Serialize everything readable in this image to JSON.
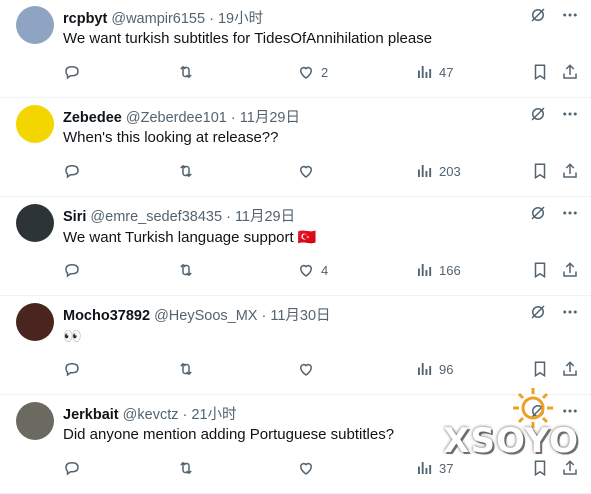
{
  "tweets": [
    {
      "name": "rcpbyt",
      "handle": "@wampir6155",
      "dot": "·",
      "time": "19小时",
      "text": "We want turkish subtitles for TidesOfAnnihilation please",
      "likes": "2",
      "views": "47",
      "avatar": "#8fa3c2"
    },
    {
      "name": "Zebedee",
      "handle": "@Zeberdee101",
      "dot": "·",
      "time": "11月29日",
      "text": "When's this looking at release??",
      "likes": "",
      "views": "203",
      "avatar": "#f3d500"
    },
    {
      "name": "Siri",
      "handle": "@emre_sedef38435",
      "dot": "·",
      "time": "11月29日",
      "text": "We want Turkish language support 🇹🇷",
      "likes": "4",
      "views": "166",
      "avatar": "#2d3438"
    },
    {
      "name": "Mocho37892",
      "handle": "@HeySoos_MX",
      "dot": "·",
      "time": "11月30日",
      "text": "👀",
      "likes": "",
      "views": "96",
      "avatar": "#4a2520"
    },
    {
      "name": "Jerkbait",
      "handle": "@kevctz",
      "dot": "·",
      "time": "21小时",
      "text": "Did anyone mention adding Portuguese subtitles?",
      "likes": "",
      "views": "37",
      "avatar": "#6b6a60"
    }
  ],
  "watermark": "XSOYO",
  "colors": {
    "text": "#0f1419",
    "muted": "#536471",
    "divider": "#eff3f4"
  },
  "icons": [
    "grok-icon",
    "more-icon",
    "reply-icon",
    "retweet-icon",
    "like-icon",
    "views-icon",
    "bookmark-icon",
    "share-icon"
  ]
}
